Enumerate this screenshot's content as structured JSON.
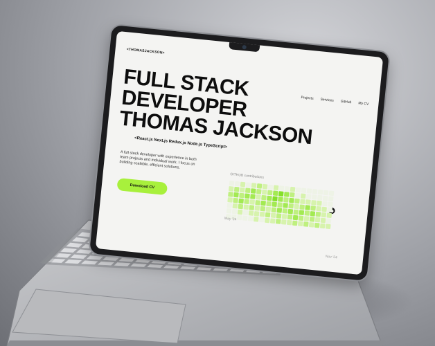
{
  "brand": "<THOMASJACKSON>",
  "nav": [
    "Projects",
    "Services",
    "GitHub",
    "My CV"
  ],
  "headline": [
    "FULL STACK DEVELOPER",
    "THOMAS JACKSON"
  ],
  "stack": "<React.js Next.js Redux.js Node.js TypeScript>",
  "bio": "A full stack developer with experience in both team projects and individual work. I focus on building scalable, efficient solutions.",
  "cta": "Download CV",
  "github": {
    "label": "GITHUB contributions",
    "start_month": "May '24",
    "end_month": "Nov '24",
    "levels": [
      [
        0,
        0,
        1,
        0,
        1,
        2,
        1,
        0,
        1,
        0,
        0,
        1,
        0,
        0,
        0,
        0,
        0,
        0,
        0
      ],
      [
        1,
        2,
        1,
        2,
        3,
        2,
        1,
        2,
        3,
        4,
        3,
        2,
        0,
        1,
        0,
        0,
        0,
        0,
        0
      ],
      [
        2,
        3,
        2,
        3,
        3,
        1,
        2,
        3,
        4,
        3,
        2,
        3,
        2,
        1,
        1,
        1,
        1,
        0,
        0
      ],
      [
        1,
        2,
        3,
        2,
        1,
        2,
        3,
        2,
        3,
        2,
        3,
        2,
        1,
        2,
        3,
        2,
        1,
        1,
        0
      ],
      [
        0,
        1,
        2,
        1,
        2,
        1,
        2,
        1,
        2,
        3,
        2,
        3,
        2,
        3,
        2,
        3,
        2,
        1,
        1
      ],
      [
        0,
        0,
        1,
        0,
        1,
        1,
        1,
        2,
        1,
        2,
        1,
        2,
        3,
        2,
        1,
        2,
        1,
        1,
        0
      ],
      [
        0,
        0,
        0,
        0,
        0,
        1,
        0,
        1,
        1,
        2,
        1,
        1,
        2,
        1,
        2,
        1,
        2,
        1,
        1
      ]
    ]
  },
  "colors": {
    "accent": "#a8f03c",
    "levels": [
      "#eef3e6",
      "#d7f3ad",
      "#bff07f",
      "#a3ea52",
      "#86e02a"
    ]
  },
  "icons": {
    "github": "github-icon",
    "camera": "camera-icon"
  }
}
